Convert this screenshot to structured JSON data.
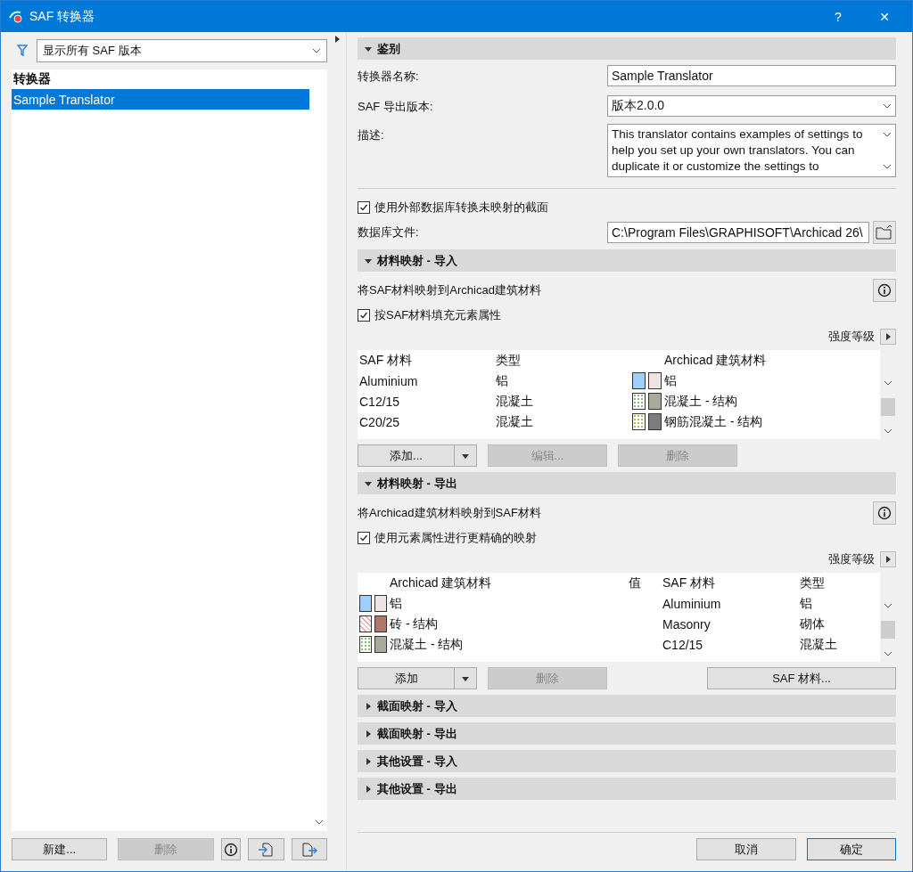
{
  "window": {
    "title": "SAF 转换器",
    "help": "?",
    "close": "✕"
  },
  "left": {
    "filter": "显示所有 SAF 版本",
    "list_header": "转换器",
    "items": [
      {
        "label": "Sample Translator",
        "selected": true
      }
    ],
    "buttons": [
      {
        "kind": "text",
        "label": "新建...",
        "disabled": false
      },
      {
        "kind": "text",
        "label": "删除",
        "disabled": true
      },
      {
        "kind": "info",
        "disabled": false
      },
      {
        "kind": "import",
        "disabled": false
      },
      {
        "kind": "export",
        "disabled": false
      }
    ]
  },
  "identification": {
    "title": "鉴别",
    "expanded": true,
    "name_label": "转换器名称:",
    "name_value": "Sample Translator",
    "version_label": "SAF 导出版本:",
    "version_value": "版本2.0.0",
    "desc_label": "描述:",
    "desc_value": "This translator contains examples of settings to help you set up your own translators. You can duplicate it or customize the settings to"
  },
  "database": {
    "checkbox": {
      "label": "使用外部数据库转换未映射的截面",
      "checked": true
    },
    "file_label": "数据库文件:",
    "file_value": "C:\\Program Files\\GRAPHISOFT\\Archicad 26\\"
  },
  "import_mapping": {
    "title": "材料映射 - 导入",
    "expanded": true,
    "description": "将SAF材料映射到Archicad建筑材料",
    "checkbox": {
      "label": "按SAF材料填充元素属性",
      "checked": true
    },
    "strength": "强度等级",
    "columns": [
      "SAF 材料",
      "类型",
      "Archicad 建筑材料"
    ],
    "rows": [
      {
        "saf": "Aluminium",
        "type": "铝",
        "swatches": [
          {
            "kind": "solid",
            "color": "#9fcfff"
          },
          {
            "kind": "solid",
            "color": "#efe3e3"
          }
        ],
        "archicad": "铝"
      },
      {
        "saf": "C12/15",
        "type": "混凝土",
        "swatches": [
          {
            "kind": "dots",
            "color": "#7fbf6f"
          },
          {
            "kind": "solid",
            "color": "#a8aa9c"
          }
        ],
        "archicad": "混凝土 - 结构"
      },
      {
        "saf": "C20/25",
        "type": "混凝土",
        "swatches": [
          {
            "kind": "dots",
            "color": "#b8b84a"
          },
          {
            "kind": "solid",
            "color": "#7c7c7c"
          }
        ],
        "archicad": "钢筋混凝土 - 结构"
      }
    ],
    "buttons": [
      {
        "label": "添加...",
        "dropdown": true,
        "disabled": false
      },
      {
        "label": "编辑...",
        "dropdown": false,
        "disabled": true
      },
      {
        "label": "删除",
        "dropdown": false,
        "disabled": true
      }
    ]
  },
  "export_mapping": {
    "title": "材料映射 - 导出",
    "expanded": true,
    "description": "将Archicad建筑材料映射到SAF材料",
    "checkbox": {
      "label": "使用元素属性进行更精确的映射",
      "checked": true
    },
    "strength": "强度等级",
    "columns": [
      "Archicad 建筑材料",
      "值",
      "SAF 材料",
      "类型"
    ],
    "rows": [
      {
        "swatches": [
          {
            "kind": "solid",
            "color": "#9fcfff"
          },
          {
            "kind": "solid",
            "color": "#efe3e3"
          }
        ],
        "archicad": "铝",
        "saf": "Aluminium",
        "type": "铝"
      },
      {
        "swatches": [
          {
            "kind": "hatch",
            "color": "#f0a0a0"
          },
          {
            "kind": "solid",
            "color": "#b07868"
          }
        ],
        "archicad": "砖 - 结构",
        "saf": "Masonry",
        "type": "砌体"
      },
      {
        "swatches": [
          {
            "kind": "dots",
            "color": "#7fbf6f"
          },
          {
            "kind": "solid",
            "color": "#a8aa9c"
          }
        ],
        "archicad": "混凝土 - 结构",
        "saf": "C12/15",
        "type": "混凝土"
      }
    ],
    "buttons": [
      {
        "label": "添加",
        "dropdown": true,
        "disabled": false
      },
      {
        "label": "删除",
        "dropdown": false,
        "disabled": true
      },
      {
        "label": "SAF 材料...",
        "dropdown": false,
        "disabled": false
      }
    ]
  },
  "collapsed_sections": [
    {
      "title": "截面映射 - 导入",
      "expanded": false
    },
    {
      "title": "截面映射 - 导出",
      "expanded": false
    },
    {
      "title": "其他设置 - 导入",
      "expanded": false
    },
    {
      "title": "其他设置 - 导出",
      "expanded": false
    }
  ],
  "footer": {
    "cancel": "取消",
    "ok": "确定"
  }
}
